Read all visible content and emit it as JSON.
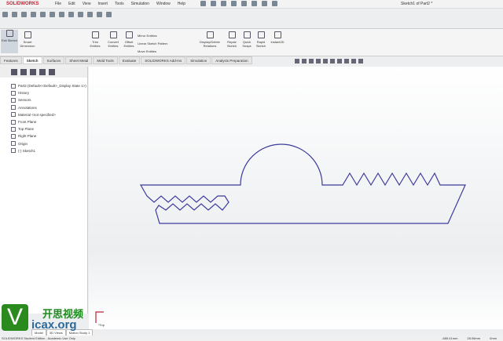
{
  "app": {
    "logo": "SOLIDWORKS",
    "doc_title": "Sketch1 of Part2 *"
  },
  "menu": [
    "File",
    "Edit",
    "View",
    "Insert",
    "Tools",
    "Simulation",
    "Window",
    "Help"
  ],
  "ribbon": [
    {
      "label": "Exit Sketch"
    },
    {
      "label": "Smart Dimension"
    },
    {
      "label": "Trim Entities"
    },
    {
      "label": "Convert Entities"
    },
    {
      "label": "Offset Entities"
    },
    {
      "label": "Mirror Entities"
    },
    {
      "label": "Linear Sketch Pattern"
    },
    {
      "label": "Move Entities"
    },
    {
      "label": "Display/Delete Relations"
    },
    {
      "label": "Repair Sketch"
    },
    {
      "label": "Quick Snaps"
    },
    {
      "label": "Rapid Sketch"
    },
    {
      "label": "Instant2D"
    }
  ],
  "tabs": [
    "Features",
    "Sketch",
    "Surfaces",
    "Sheet Metal",
    "Mold Tools",
    "Evaluate",
    "SOLIDWORKS Add-Ins",
    "Simulation",
    "Analysis Preparation"
  ],
  "active_tab": "Sketch",
  "tree": [
    "Part2 (Default<<Default>_Display State 1>)",
    "History",
    "Sensors",
    "Annotations",
    "Material <not specified>",
    "Front Plane",
    "Top Plane",
    "Right Plane",
    "Origin",
    "(-) Sketch1"
  ],
  "model_tabs": [
    "Model",
    "3D Views",
    "Motion Study 1"
  ],
  "view_label": "*Top",
  "status": {
    "left": "SOLIDWORKS Student Edition - Academic Use Only",
    "coords": [
      "-685.41mm",
      "28.06mm",
      "0mm"
    ]
  },
  "watermark": {
    "letter": "V",
    "cn": "开思视频",
    "url": "icax.org"
  }
}
